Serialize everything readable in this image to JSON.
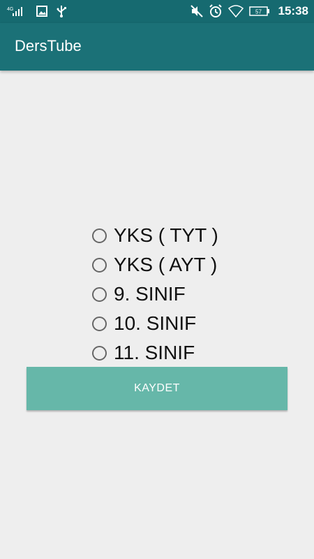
{
  "status_bar": {
    "network_label": "4G",
    "battery_level": "57",
    "time": "15:38",
    "icons": [
      "signal-icon",
      "image-icon",
      "usb-icon",
      "mute-icon",
      "alarm-icon",
      "wifi-icon",
      "battery-icon"
    ]
  },
  "app_bar": {
    "title": "DersTube",
    "color": "#1b7177"
  },
  "options": [
    {
      "label": "YKS ( TYT )",
      "selected": false
    },
    {
      "label": "YKS ( AYT )",
      "selected": false
    },
    {
      "label": "9. SINIF",
      "selected": false
    },
    {
      "label": "10. SINIF",
      "selected": false
    },
    {
      "label": "11. SINIF",
      "selected": false
    }
  ],
  "save_button": {
    "label": "KAYDET",
    "color": "#66b7a9"
  }
}
